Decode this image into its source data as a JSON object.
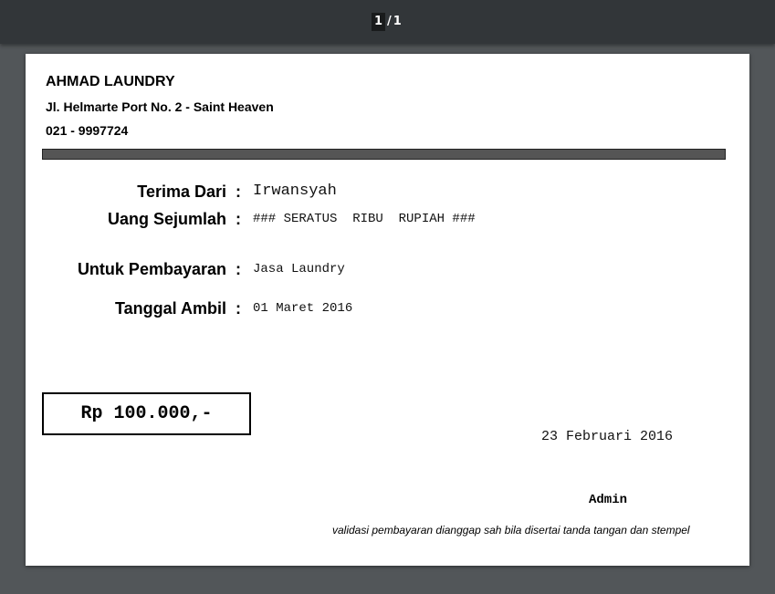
{
  "viewer": {
    "page_current": "1",
    "page_separator": "/",
    "page_total": "1"
  },
  "receipt": {
    "company_name": "AHMAD LAUNDRY",
    "company_address": "Jl. Helmarte Port No. 2 - Saint Heaven",
    "company_phone": "021 - 9997724",
    "colon": ":",
    "fields": [
      {
        "label": "Terima Dari",
        "value": "Irwansyah"
      },
      {
        "label": "Uang Sejumlah",
        "value": "### SERATUS  RIBU  RUPIAH ###"
      },
      {
        "label": "Untuk Pembayaran",
        "value": "Jasa Laundry"
      },
      {
        "label": "Tanggal Ambil",
        "value": "01 Maret 2016"
      }
    ],
    "amount": "Rp 100.000,-",
    "issue_date": "23 Februari 2016",
    "signer": "Admin",
    "validation_note": "validasi pembayaran dianggap sah bila disertai tanda tangan dan stempel"
  }
}
